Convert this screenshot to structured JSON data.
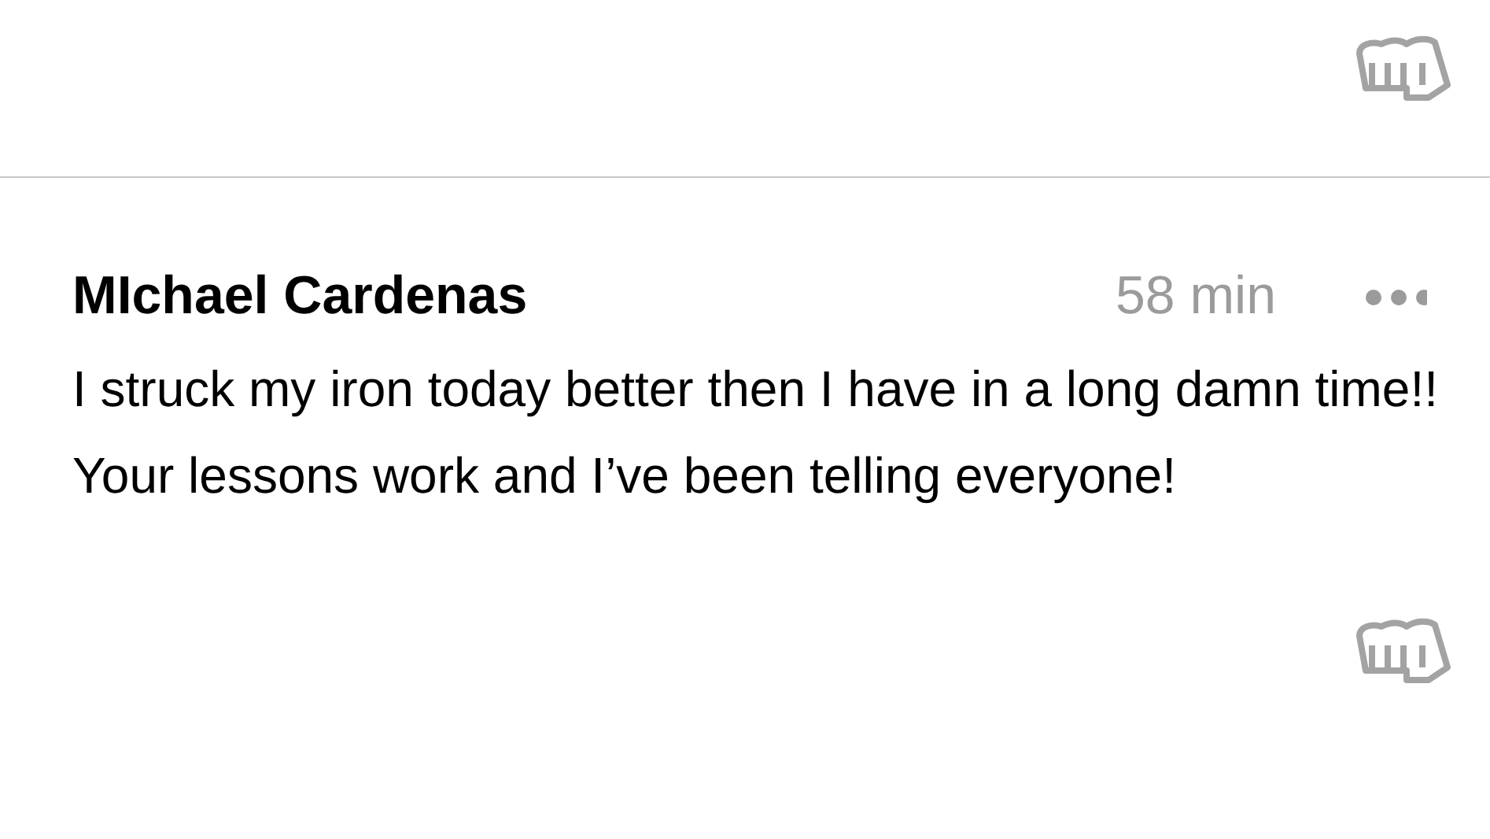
{
  "comment": {
    "author": "MIchael Cardenas",
    "time": "58 min",
    "text": "I struck my iron today better then I have in a long damn time!! Your lessons work and I’ve been telling everyone!"
  }
}
